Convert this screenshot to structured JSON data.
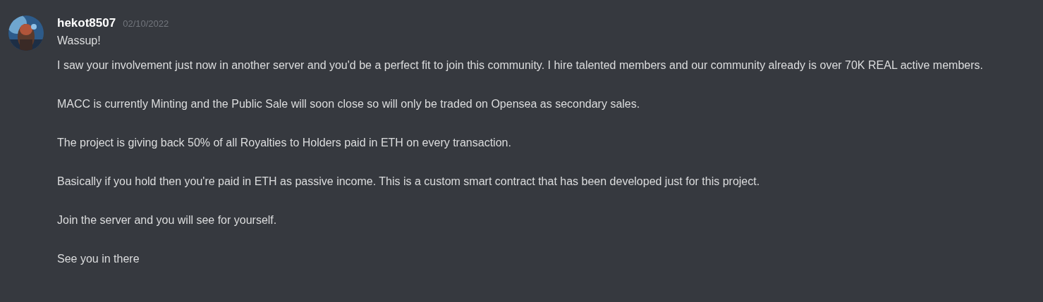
{
  "message": {
    "author": "hekot8507",
    "timestamp": "02/10/2022",
    "lines": [
      "Wassup!"
    ],
    "paragraphs": [
      "I saw your involvement just now in another server and you'd be a perfect fit to join this community. I hire talented members and our community already is over 70K REAL active members.",
      "MACC is currently Minting and the Public Sale will soon close so will only be traded on Opensea as secondary sales.",
      "The project is giving back 50% of all Royalties to Holders paid in ETH on every transaction.",
      "Basically if you hold then you're paid in ETH as passive income. This is a custom smart contract that has been developed just for this project.",
      "Join the server and you will see for yourself.",
      "See you in there"
    ]
  }
}
